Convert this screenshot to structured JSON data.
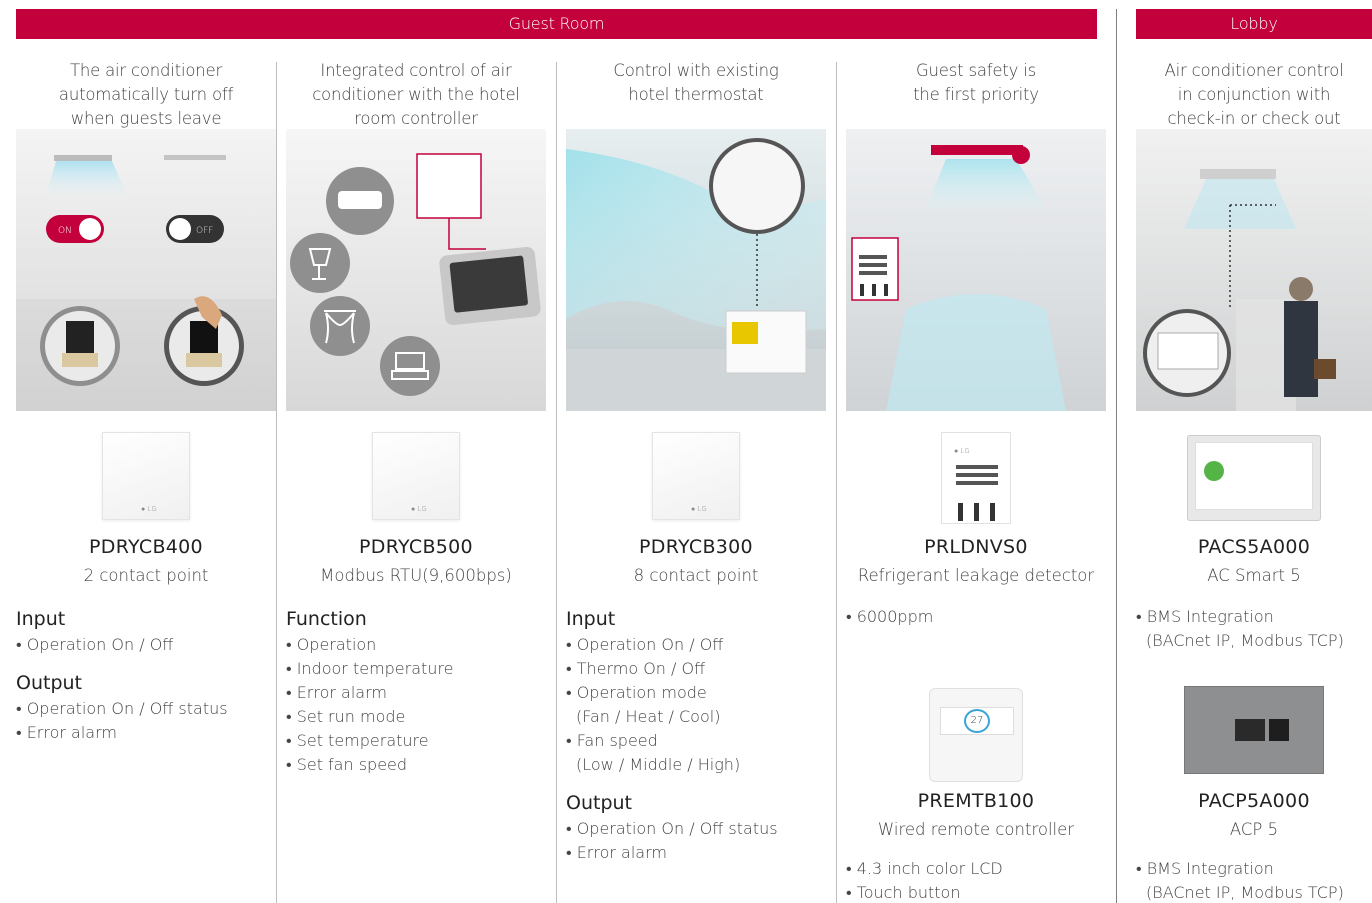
{
  "banners": {
    "guest_room": "Guest Room",
    "lobby": "Lobby"
  },
  "scene1": {
    "switch_on": "ON",
    "switch_off": "OFF"
  },
  "columns": [
    {
      "caption": [
        "The air conditioner",
        "automatically turn off",
        "when guests leave"
      ],
      "product_name": "PDRYCB400",
      "product_desc": "2 contact point",
      "sections": [
        {
          "heading": "Input",
          "items": [
            "Operation On / Off"
          ]
        },
        {
          "heading": "Output",
          "items": [
            "Operation On / Off status",
            "Error alarm"
          ]
        }
      ]
    },
    {
      "caption": [
        "Integrated control of air",
        "conditioner with the hotel",
        "room controller"
      ],
      "product_name": "PDRYCB500",
      "product_desc": "Modbus RTU(9,600bps)",
      "sections": [
        {
          "heading": "Function",
          "items": [
            "Operation",
            "Indoor temperature",
            "Error alarm",
            "Set run mode",
            "Set temperature",
            "Set fan speed"
          ]
        }
      ]
    },
    {
      "caption": [
        "Control with existing",
        "hotel thermostat"
      ],
      "product_name": "PDRYCB300",
      "product_desc": "8 contact point",
      "sections": [
        {
          "heading": "Input",
          "items": [
            "Operation On / Off",
            "Thermo On / Off",
            "Operation mode",
            "(Fan / Heat / Cool)",
            "Fan speed",
            "(Low / Middle / High)"
          ]
        },
        {
          "heading": "Output",
          "items": [
            "Operation On / Off status",
            "Error alarm"
          ]
        }
      ]
    },
    {
      "caption": [
        "Guest safety is",
        "the first priority"
      ],
      "product_name": "PRLDNVS0",
      "product_desc": "Refrigerant leakage detector",
      "specs": [
        "6000ppm"
      ],
      "product2_name": "PREMTB100",
      "product2_desc": "Wired remote controller",
      "specs2": [
        "4.3 inch color LCD",
        "Touch button"
      ],
      "remote_temp": "27"
    },
    {
      "caption": [
        "Air conditioner control",
        "in conjunction with",
        "check-in or check out"
      ],
      "product_name": "PACS5A000",
      "product_desc": "AC Smart 5",
      "specs": [
        "BMS Integration",
        "(BACnet IP, Modbus TCP)"
      ],
      "product2_name": "PACP5A000",
      "product2_desc": "ACP 5",
      "specs2": [
        "BMS Integration",
        "(BACnet IP, Modbus TCP)"
      ]
    }
  ],
  "colors": {
    "brand_red": "#c4003c",
    "text": "#444444"
  },
  "icons": [
    "aircon-icon",
    "lamp-icon",
    "curtain-icon",
    "tv-icon",
    "keycard-icon",
    "toggle-switch-icon",
    "leak-detector-icon"
  ]
}
